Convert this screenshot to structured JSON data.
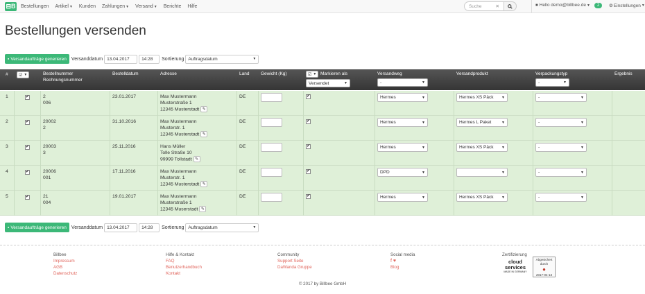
{
  "nav": {
    "logo": "⊟B",
    "items": [
      {
        "label": "Bestellungen",
        "dropdown": false
      },
      {
        "label": "Artikel",
        "dropdown": true
      },
      {
        "label": "Kunden",
        "dropdown": false
      },
      {
        "label": "Zahlungen",
        "dropdown": true
      },
      {
        "label": "Versand",
        "dropdown": true
      },
      {
        "label": "Berichte",
        "dropdown": false
      },
      {
        "label": "Hilfe",
        "dropdown": false
      }
    ],
    "search_placeholder": "Suche",
    "user": "Hello demo@billbee.de",
    "notifications": "2",
    "settings": "Einstellungen"
  },
  "page_title": "Bestellungen versenden",
  "toolbar": {
    "generate_label": "Versandaufträge generieren",
    "shipdate_label": "Versanddatum",
    "date": "13.04.2017",
    "time": "14:28",
    "sort_label": "Sortierung",
    "sort_value": "Auftragsdatum"
  },
  "table": {
    "headers": {
      "num": "#",
      "order": "Bestellnummer",
      "invoice": "Rechnungsnummer",
      "date": "Bestelldatum",
      "address": "Adresse",
      "country": "Land",
      "weight": "Gewicht (Kg)",
      "mark_as": "Markieren als",
      "mark_value": "Versendet",
      "method": "Versandweg",
      "method_value": "-",
      "product": "Versandprodukt",
      "packaging": "Verpackungstyp",
      "packaging_value": "-",
      "result": "Ergebnis"
    },
    "rows": [
      {
        "num": "1",
        "order": "2",
        "invoice": "006",
        "date": "23.01.2017",
        "addr1": "Max Mustermann",
        "addr2": "Musterstraße 1",
        "addr3": "12345 Musterstadt",
        "country": "DE",
        "method": "Hermes",
        "product": "Hermes XS Päck",
        "packaging": "-"
      },
      {
        "num": "2",
        "order": "20002",
        "invoice": "2",
        "date": "31.10.2016",
        "addr1": "Max Mustermann",
        "addr2": "Musterstr. 1",
        "addr3": "12345 Musterstadt",
        "country": "DE",
        "method": "Hermes",
        "product": "Hermes L Paket",
        "packaging": "-"
      },
      {
        "num": "3",
        "order": "20003",
        "invoice": "3",
        "date": "25.11.2016",
        "addr1": "Hans Müller",
        "addr2": "Tolle Straße 10",
        "addr3": "99999 Tollstadt",
        "country": "DE",
        "method": "Hermes",
        "product": "Hermes XS Päck",
        "packaging": "-"
      },
      {
        "num": "4",
        "order": "20006",
        "invoice": "001",
        "date": "17.11.2016",
        "addr1": "Max Mustermann",
        "addr2": "Musterstr. 1",
        "addr3": "12345 Musterstadt",
        "country": "DE",
        "method": "DPD",
        "product": "",
        "packaging": "-"
      },
      {
        "num": "5",
        "order": "21",
        "invoice": "004",
        "date": "19.01.2017",
        "addr1": "Max Mustermann",
        "addr2": "Musterstraße 1",
        "addr3": "12345 Muserstadt",
        "country": "DE",
        "method": "Hermes",
        "product": "Hermes XS Päck",
        "packaging": "-"
      }
    ]
  },
  "footer": {
    "columns": [
      {
        "heading": "Billbee",
        "links": [
          "Impressum",
          "AGB",
          "Datenschutz"
        ]
      },
      {
        "heading": "Hilfe & Kontakt",
        "links": [
          "FAQ",
          "Benutzerhandbuch",
          "Kontakt"
        ]
      },
      {
        "heading": "Community",
        "links": [
          "Support Seite",
          "DaWanda Gruppe"
        ]
      },
      {
        "heading": "Social media",
        "links": [
          "Blog"
        ]
      },
      {
        "heading": "Zertifizierung",
        "links": []
      }
    ],
    "social_icons": "f ♥",
    "cert_cloud_1": "cloud",
    "cert_cloud_2": "services",
    "cert_cloud_3": "MADE IN GERMANY",
    "cert_audit_1": "Abgesichert durch",
    "cert_audit_2": "2017-04-13",
    "copyright": "© 2017 by Billbee GmbH"
  },
  "colors": {
    "accent": "#3cb878",
    "row_bg": "#dff0d8",
    "header_bg": "#444444",
    "link": "#e0655c"
  }
}
